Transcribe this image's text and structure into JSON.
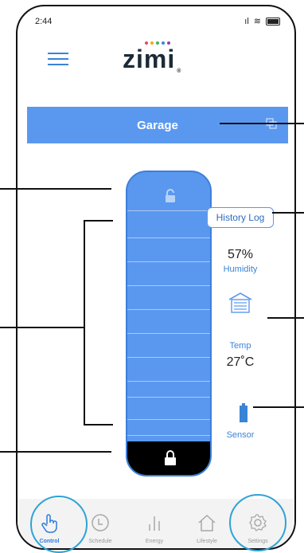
{
  "status": {
    "time": "2:44"
  },
  "logo": {
    "text": "zimi",
    "dot_colors": [
      "#e84a5f",
      "#f5a623",
      "#3cba54",
      "#3a84d6",
      "#8e44ad"
    ]
  },
  "room": {
    "title": "Garage"
  },
  "door": {
    "state": "locked",
    "slats": 11
  },
  "history_button": {
    "label": "History Log"
  },
  "humidity": {
    "value": "57%",
    "label": "Humidity"
  },
  "temperature": {
    "label": "Temp",
    "value": "27˚C"
  },
  "sensor": {
    "label": "Sensor",
    "level": 1.0
  },
  "tabs": [
    {
      "label": "Control",
      "icon": "hand-pointer-icon",
      "active": true
    },
    {
      "label": "Schedule",
      "icon": "clock-icon",
      "active": false
    },
    {
      "label": "Energy",
      "icon": "bar-chart-icon",
      "active": false
    },
    {
      "label": "Lifestyle",
      "icon": "house-icon",
      "active": false
    },
    {
      "label": "Settings",
      "icon": "gear-icon",
      "active": false
    }
  ],
  "colors": {
    "accent": "#5a98f0",
    "highlight_circle": "#2ea3d6",
    "door_bottom": "#000000"
  }
}
